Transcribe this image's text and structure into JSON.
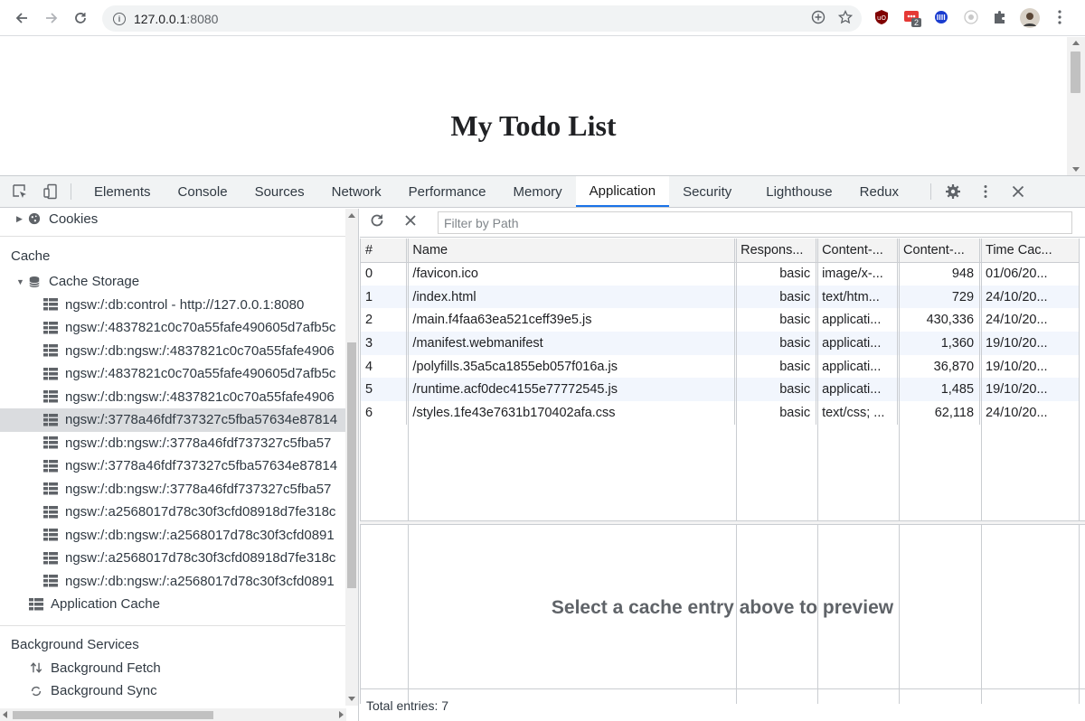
{
  "browser": {
    "url_host": "127.0.0.1",
    "url_port": ":8080",
    "ext_badge": "2"
  },
  "page": {
    "heading": "My Todo List"
  },
  "devtools": {
    "tabs": [
      "Elements",
      "Console",
      "Sources",
      "Network",
      "Performance",
      "Memory",
      "Application",
      "Security",
      "Lighthouse",
      "Redux"
    ],
    "active_tab": "Application"
  },
  "sidebar": {
    "cookies_label": "Cookies",
    "cache_header": "Cache",
    "cache_storage_label": "Cache Storage",
    "cache_items": [
      "ngsw:/:db:control - http://127.0.0.1:8080",
      "ngsw:/:4837821c0c70a55fafe490605d7afb5c",
      "ngsw:/:db:ngsw:/:4837821c0c70a55fafe4906",
      "ngsw:/:4837821c0c70a55fafe490605d7afb5c",
      "ngsw:/:db:ngsw:/:4837821c0c70a55fafe4906",
      "ngsw:/:3778a46fdf737327c5fba57634e87814",
      "ngsw:/:db:ngsw:/:3778a46fdf737327c5fba57",
      "ngsw:/:3778a46fdf737327c5fba57634e87814",
      "ngsw:/:db:ngsw:/:3778a46fdf737327c5fba57",
      "ngsw:/:a2568017d78c30f3cfd08918d7fe318c",
      "ngsw:/:db:ngsw:/:a2568017d78c30f3cfd0891",
      "ngsw:/:a2568017d78c30f3cfd08918d7fe318c",
      "ngsw:/:db:ngsw:/:a2568017d78c30f3cfd0891"
    ],
    "app_cache_label": "Application Cache",
    "bg_services_header": "Background Services",
    "bg_fetch_label": "Background Fetch",
    "bg_sync_label": "Background Sync"
  },
  "toolbar": {
    "filter_placeholder": "Filter by Path"
  },
  "table": {
    "columns": [
      "#",
      "Name",
      "Respons...",
      "Content-...",
      "Content-...",
      "Time Cac..."
    ],
    "rows": [
      [
        "0",
        "/favicon.ico",
        "basic",
        "image/x-...",
        "948",
        "01/06/20..."
      ],
      [
        "1",
        "/index.html",
        "basic",
        "text/htm...",
        "729",
        "24/10/20..."
      ],
      [
        "2",
        "/main.f4faa63ea521ceff39e5.js",
        "basic",
        "applicati...",
        "430,336",
        "24/10/20..."
      ],
      [
        "3",
        "/manifest.webmanifest",
        "basic",
        "applicati...",
        "1,360",
        "19/10/20..."
      ],
      [
        "4",
        "/polyfills.35a5ca1855eb057f016a.js",
        "basic",
        "applicati...",
        "36,870",
        "19/10/20..."
      ],
      [
        "5",
        "/runtime.acf0dec4155e77772545.js",
        "basic",
        "applicati...",
        "1,485",
        "19/10/20..."
      ],
      [
        "6",
        "/styles.1fe43e7631b170402afa.css",
        "basic",
        "text/css; ...",
        "62,118",
        "24/10/20..."
      ]
    ]
  },
  "preview": {
    "message": "Select a cache entry above to preview"
  },
  "footer": {
    "total": "Total entries: 7"
  },
  "colors": {
    "accent": "#1a73e8",
    "selected_row": "#dadcdf",
    "alt_row": "#f2f6fd"
  }
}
